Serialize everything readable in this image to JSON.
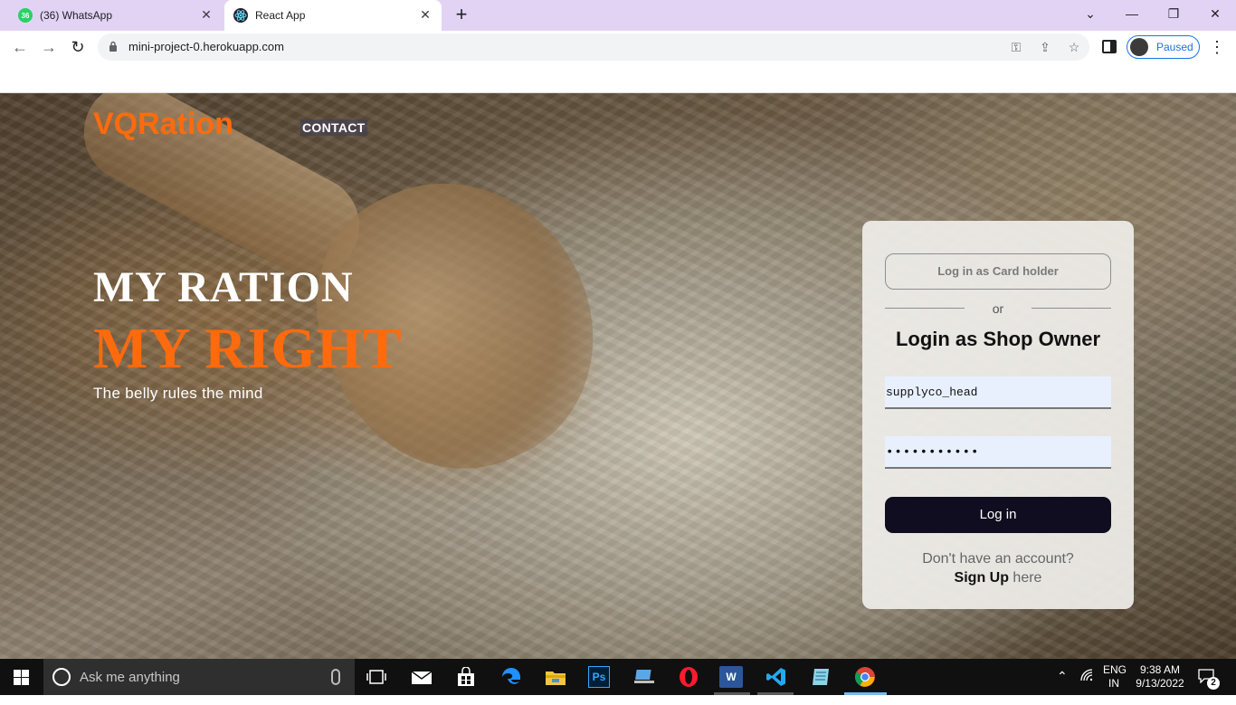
{
  "browser": {
    "tabs": [
      {
        "title": "(36) WhatsApp",
        "badge": "36",
        "icon": "whatsapp-icon",
        "active": false
      },
      {
        "title": "React App",
        "icon": "react-icon",
        "active": true
      }
    ],
    "new_tab_symbol": "+",
    "url": "mini-project-0.herokuapp.com",
    "profile_status": "Paused",
    "window_controls": {
      "chevron": "⌄",
      "minimize": "—",
      "restore": "❐",
      "close": "✕"
    }
  },
  "page": {
    "brand": "VQRation",
    "nav": {
      "contact": "CONTACT"
    },
    "hero": {
      "line1": "MY RATION",
      "line2": "MY RIGHT",
      "tagline": "The belly rules the mind"
    },
    "login_card": {
      "cardholder_button": "Log in as Card holder",
      "divider_text": "or",
      "title": "Login as Shop Owner",
      "username_value": "supplyco_head",
      "password_mask": "•••••••••••",
      "login_button": "Log in",
      "no_account_text": "Don't have an account?",
      "signup_link": "Sign Up",
      "signup_suffix": " here"
    },
    "colors": {
      "brand": "#ff6a0d",
      "button_dark": "#0f0d1f"
    }
  },
  "taskbar": {
    "search_placeholder": "Ask me anything",
    "apps": [
      "task-view-icon",
      "mail-icon",
      "store-icon",
      "edge-icon",
      "file-explorer-icon",
      "photoshop-icon",
      "laptop-app-icon",
      "opera-icon",
      "word-icon",
      "vscode-icon",
      "notes-app-icon",
      "chrome-icon"
    ],
    "ps_label": "Ps",
    "word_label": "W",
    "language": "ENG",
    "region": "IN",
    "time": "9:38 AM",
    "date": "9/13/2022",
    "notification_count": "2"
  }
}
